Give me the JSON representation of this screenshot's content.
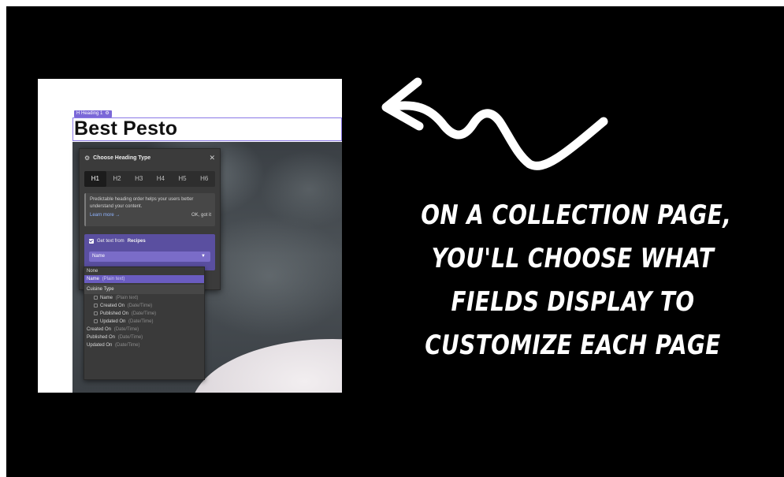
{
  "screenshot": {
    "heading_tag": "H Heading 1",
    "heading_text": "Best Pesto",
    "panel": {
      "title": "Choose Heading Type",
      "close_icon": "close-icon",
      "tabs": [
        "H1",
        "H2",
        "H3",
        "H4",
        "H5",
        "H6"
      ],
      "active_tab": "H1",
      "tip_text": "Predictable heading order helps your users better understand your content.",
      "learn_more": "Learn more →",
      "ok_label": "OK, got it",
      "source_label": "Get text from",
      "source_collection": "Recipes",
      "source_checked": true,
      "selected_field": "Name"
    },
    "dropdown": {
      "options": [
        {
          "label": "None",
          "type": "",
          "style": "plain"
        },
        {
          "label": "Name",
          "type": "(Plain text)",
          "style": "selected"
        },
        {
          "label": "Cuisine Type",
          "type": "",
          "style": "group"
        },
        {
          "label": "Name",
          "type": "(Plain text)",
          "style": "indent"
        },
        {
          "label": "Created On",
          "type": "(Date/Time)",
          "style": "indent"
        },
        {
          "label": "Published On",
          "type": "(Date/Time)",
          "style": "indent"
        },
        {
          "label": "Updated On",
          "type": "(Date/Time)",
          "style": "indent"
        },
        {
          "label": "Created On",
          "type": "(Date/Time)",
          "style": "plain"
        },
        {
          "label": "Published On",
          "type": "(Date/Time)",
          "style": "plain"
        },
        {
          "label": "Updated On",
          "type": "(Date/Time)",
          "style": "plain"
        }
      ]
    }
  },
  "caption": {
    "lines": [
      "ON A COLLECTION PAGE,",
      "YOU'LL CHOOSE WHAT",
      "FIELDS DISPLAY TO",
      "CUSTOMIZE EACH PAGE"
    ]
  },
  "colors": {
    "background": "#000000",
    "accent": "#7b68d8",
    "caption": "#ffffff"
  },
  "icons": [
    "settings-icon",
    "close-icon",
    "check-icon",
    "chevron-down-icon",
    "arrow-icon"
  ]
}
